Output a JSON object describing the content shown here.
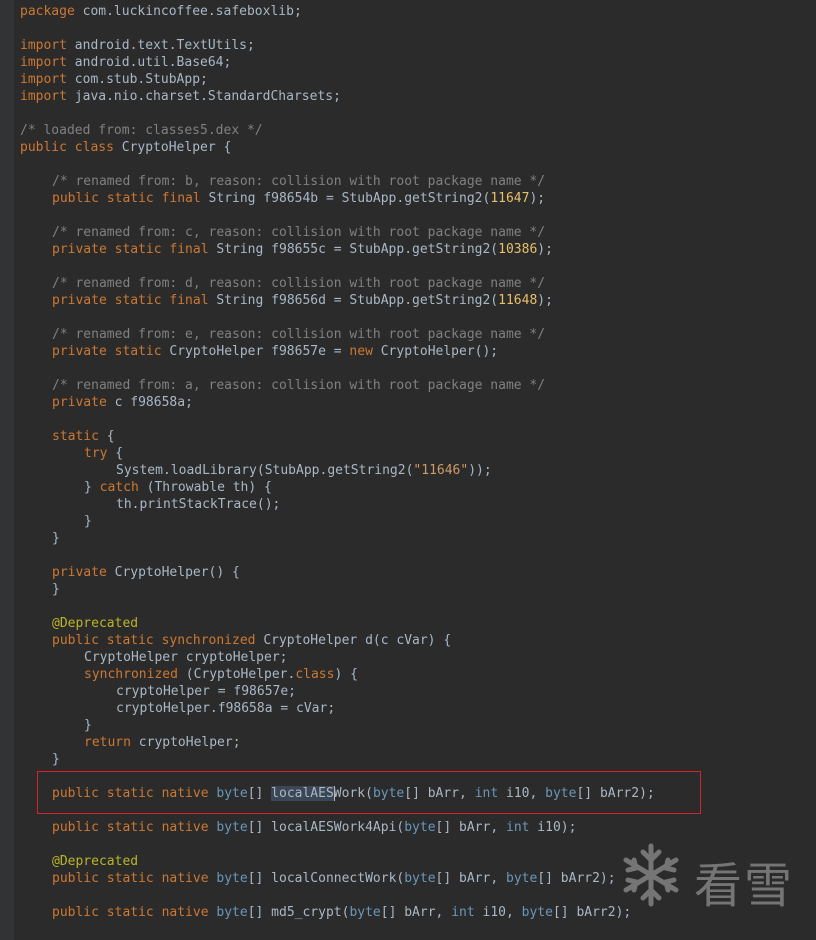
{
  "editor": {
    "lines": [
      {
        "row": 0,
        "indent": 0,
        "tokens": [
          [
            "kw",
            "package"
          ],
          [
            "plain",
            " com.luckincoffee.safeboxlib;"
          ]
        ]
      },
      {
        "row": 2,
        "indent": 0,
        "tokens": [
          [
            "kw",
            "import"
          ],
          [
            "plain",
            " android.text.TextUtils;"
          ]
        ]
      },
      {
        "row": 3,
        "indent": 0,
        "tokens": [
          [
            "kw",
            "import"
          ],
          [
            "plain",
            " android.util.Base64;"
          ]
        ]
      },
      {
        "row": 4,
        "indent": 0,
        "tokens": [
          [
            "kw",
            "import"
          ],
          [
            "plain",
            " com.stub.StubApp;"
          ]
        ]
      },
      {
        "row": 5,
        "indent": 0,
        "tokens": [
          [
            "kw",
            "import"
          ],
          [
            "plain",
            " java.nio.charset.StandardCharsets;"
          ]
        ]
      },
      {
        "row": 7,
        "indent": 0,
        "tokens": [
          [
            "cm",
            "/* loaded from: classes5.dex */"
          ]
        ]
      },
      {
        "row": 8,
        "indent": 0,
        "tokens": [
          [
            "kw",
            "public class"
          ],
          [
            "plain",
            " CryptoHelper {"
          ]
        ]
      },
      {
        "row": 10,
        "indent": 1,
        "tokens": [
          [
            "cm",
            "/* renamed from: b, reason: collision with root package name */"
          ]
        ]
      },
      {
        "row": 11,
        "indent": 1,
        "tokens": [
          [
            "kw",
            "public static final"
          ],
          [
            "plain",
            " String f98654b = StubApp.getString2("
          ],
          [
            "numy",
            "11647"
          ],
          [
            "plain",
            ");"
          ]
        ]
      },
      {
        "row": 13,
        "indent": 1,
        "tokens": [
          [
            "cm",
            "/* renamed from: c, reason: collision with root package name */"
          ]
        ]
      },
      {
        "row": 14,
        "indent": 1,
        "tokens": [
          [
            "kw",
            "private static final"
          ],
          [
            "plain",
            " String f98655c = StubApp.getString2("
          ],
          [
            "numy",
            "10386"
          ],
          [
            "plain",
            ");"
          ]
        ]
      },
      {
        "row": 16,
        "indent": 1,
        "tokens": [
          [
            "cm",
            "/* renamed from: d, reason: collision with root package name */"
          ]
        ]
      },
      {
        "row": 17,
        "indent": 1,
        "tokens": [
          [
            "kw",
            "private static final"
          ],
          [
            "plain",
            " String f98656d = StubApp.getString2("
          ],
          [
            "numy",
            "11648"
          ],
          [
            "plain",
            ");"
          ]
        ]
      },
      {
        "row": 19,
        "indent": 1,
        "tokens": [
          [
            "cm",
            "/* renamed from: e, reason: collision with root package name */"
          ]
        ]
      },
      {
        "row": 20,
        "indent": 1,
        "tokens": [
          [
            "kw",
            "private static"
          ],
          [
            "plain",
            " CryptoHelper f98657e = "
          ],
          [
            "kw",
            "new"
          ],
          [
            "plain",
            " CryptoHelper();"
          ]
        ]
      },
      {
        "row": 22,
        "indent": 1,
        "tokens": [
          [
            "cm",
            "/* renamed from: a, reason: collision with root package name */"
          ]
        ]
      },
      {
        "row": 23,
        "indent": 1,
        "tokens": [
          [
            "kw",
            "private"
          ],
          [
            "plain",
            " c f98658a;"
          ]
        ]
      },
      {
        "row": 25,
        "indent": 1,
        "tokens": [
          [
            "kw",
            "static"
          ],
          [
            "plain",
            " {"
          ]
        ]
      },
      {
        "row": 26,
        "indent": 2,
        "tokens": [
          [
            "kw",
            "try"
          ],
          [
            "plain",
            " {"
          ]
        ]
      },
      {
        "row": 27,
        "indent": 3,
        "tokens": [
          [
            "plain",
            "System.loadLibrary(StubApp.getString2("
          ],
          [
            "strorange",
            "\"11646\""
          ],
          [
            "plain",
            "));"
          ]
        ]
      },
      {
        "row": 28,
        "indent": 2,
        "tokens": [
          [
            "plain",
            "} "
          ],
          [
            "kw",
            "catch"
          ],
          [
            "plain",
            " (Throwable th) {"
          ]
        ]
      },
      {
        "row": 29,
        "indent": 3,
        "tokens": [
          [
            "plain",
            "th.printStackTrace();"
          ]
        ]
      },
      {
        "row": 30,
        "indent": 2,
        "tokens": [
          [
            "plain",
            "}"
          ]
        ]
      },
      {
        "row": 31,
        "indent": 1,
        "tokens": [
          [
            "plain",
            "}"
          ]
        ]
      },
      {
        "row": 33,
        "indent": 1,
        "tokens": [
          [
            "kw",
            "private"
          ],
          [
            "plain",
            " CryptoHelper() {"
          ]
        ]
      },
      {
        "row": 34,
        "indent": 1,
        "tokens": [
          [
            "plain",
            "}"
          ]
        ]
      },
      {
        "row": 36,
        "indent": 1,
        "tokens": [
          [
            "ann",
            "@Deprecated"
          ]
        ]
      },
      {
        "row": 37,
        "indent": 1,
        "tokens": [
          [
            "kw",
            "public static synchronized"
          ],
          [
            "plain",
            " CryptoHelper d(c cVar) {"
          ]
        ]
      },
      {
        "row": 38,
        "indent": 2,
        "tokens": [
          [
            "plain",
            "CryptoHelper cryptoHelper;"
          ]
        ]
      },
      {
        "row": 39,
        "indent": 2,
        "tokens": [
          [
            "kw",
            "synchronized"
          ],
          [
            "plain",
            " (CryptoHelper."
          ],
          [
            "kw",
            "class"
          ],
          [
            "plain",
            ") {"
          ]
        ]
      },
      {
        "row": 40,
        "indent": 3,
        "tokens": [
          [
            "plain",
            "cryptoHelper = f98657e;"
          ]
        ]
      },
      {
        "row": 41,
        "indent": 3,
        "tokens": [
          [
            "plain",
            "cryptoHelper.f98658a = cVar;"
          ]
        ]
      },
      {
        "row": 42,
        "indent": 2,
        "tokens": [
          [
            "plain",
            "}"
          ]
        ]
      },
      {
        "row": 43,
        "indent": 2,
        "tokens": [
          [
            "kw",
            "return"
          ],
          [
            "plain",
            " cryptoHelper;"
          ]
        ]
      },
      {
        "row": 44,
        "indent": 1,
        "tokens": [
          [
            "plain",
            "}"
          ]
        ]
      },
      {
        "row": 46,
        "indent": 1,
        "tokens": [
          [
            "kw",
            "public static native"
          ],
          [
            "plain",
            " "
          ],
          [
            "typ",
            "byte"
          ],
          [
            "plain",
            "[] "
          ],
          [
            "sel",
            "localAES"
          ],
          [
            "caret",
            ""
          ],
          [
            "plain",
            "Work("
          ],
          [
            "typ",
            "byte"
          ],
          [
            "plain",
            "[] bArr, "
          ],
          [
            "typ",
            "int"
          ],
          [
            "plain",
            " i10, "
          ],
          [
            "typ",
            "byte"
          ],
          [
            "plain",
            "[] bArr2);"
          ]
        ]
      },
      {
        "row": 48,
        "indent": 1,
        "tokens": [
          [
            "kw",
            "public static native"
          ],
          [
            "plain",
            " "
          ],
          [
            "typ",
            "byte"
          ],
          [
            "plain",
            "[] localAESWork4Api("
          ],
          [
            "typ",
            "byte"
          ],
          [
            "plain",
            "[] bArr, "
          ],
          [
            "typ",
            "int"
          ],
          [
            "plain",
            " i10);"
          ]
        ]
      },
      {
        "row": 50,
        "indent": 1,
        "tokens": [
          [
            "ann",
            "@Deprecated"
          ]
        ]
      },
      {
        "row": 51,
        "indent": 1,
        "tokens": [
          [
            "kw",
            "public static native"
          ],
          [
            "plain",
            " "
          ],
          [
            "typ",
            "byte"
          ],
          [
            "plain",
            "[] localConnectWork("
          ],
          [
            "typ",
            "byte"
          ],
          [
            "plain",
            "[] bArr, "
          ],
          [
            "typ",
            "byte"
          ],
          [
            "plain",
            "[] bArr2);"
          ]
        ]
      },
      {
        "row": 53,
        "indent": 1,
        "tokens": [
          [
            "kw",
            "public static native"
          ],
          [
            "plain",
            " "
          ],
          [
            "typ",
            "byte"
          ],
          [
            "plain",
            "[] md5_crypt("
          ],
          [
            "typ",
            "byte"
          ],
          [
            "plain",
            "[] bArr, "
          ],
          [
            "typ",
            "int"
          ],
          [
            "plain",
            " i10, "
          ],
          [
            "typ",
            "byte"
          ],
          [
            "plain",
            "[] bArr2);"
          ]
        ]
      }
    ]
  },
  "watermark": {
    "text": "看雪",
    "icon": "snowflake-icon"
  },
  "colors": {
    "keyword": "#cc7832",
    "comment": "#808080",
    "annotation": "#bbb529",
    "type": "#6897bb",
    "number": "#e8bf6a",
    "string": "#d19a66",
    "highlight": "#d6232b"
  }
}
